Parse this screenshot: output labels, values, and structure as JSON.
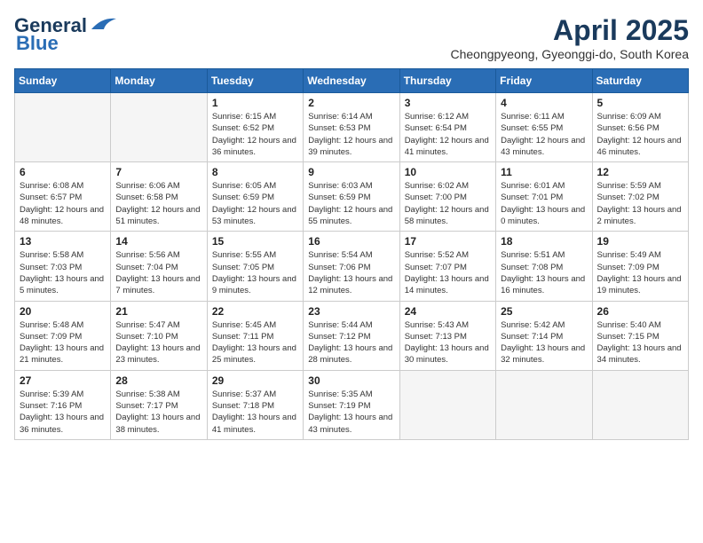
{
  "logo": {
    "general": "General",
    "blue": "Blue"
  },
  "title": {
    "month": "April 2025",
    "location": "Cheongpyeong, Gyeonggi-do, South Korea"
  },
  "headers": [
    "Sunday",
    "Monday",
    "Tuesday",
    "Wednesday",
    "Thursday",
    "Friday",
    "Saturday"
  ],
  "weeks": [
    [
      {
        "day": "",
        "info": ""
      },
      {
        "day": "",
        "info": ""
      },
      {
        "day": "1",
        "info": "Sunrise: 6:15 AM\nSunset: 6:52 PM\nDaylight: 12 hours and 36 minutes."
      },
      {
        "day": "2",
        "info": "Sunrise: 6:14 AM\nSunset: 6:53 PM\nDaylight: 12 hours and 39 minutes."
      },
      {
        "day": "3",
        "info": "Sunrise: 6:12 AM\nSunset: 6:54 PM\nDaylight: 12 hours and 41 minutes."
      },
      {
        "day": "4",
        "info": "Sunrise: 6:11 AM\nSunset: 6:55 PM\nDaylight: 12 hours and 43 minutes."
      },
      {
        "day": "5",
        "info": "Sunrise: 6:09 AM\nSunset: 6:56 PM\nDaylight: 12 hours and 46 minutes."
      }
    ],
    [
      {
        "day": "6",
        "info": "Sunrise: 6:08 AM\nSunset: 6:57 PM\nDaylight: 12 hours and 48 minutes."
      },
      {
        "day": "7",
        "info": "Sunrise: 6:06 AM\nSunset: 6:58 PM\nDaylight: 12 hours and 51 minutes."
      },
      {
        "day": "8",
        "info": "Sunrise: 6:05 AM\nSunset: 6:59 PM\nDaylight: 12 hours and 53 minutes."
      },
      {
        "day": "9",
        "info": "Sunrise: 6:03 AM\nSunset: 6:59 PM\nDaylight: 12 hours and 55 minutes."
      },
      {
        "day": "10",
        "info": "Sunrise: 6:02 AM\nSunset: 7:00 PM\nDaylight: 12 hours and 58 minutes."
      },
      {
        "day": "11",
        "info": "Sunrise: 6:01 AM\nSunset: 7:01 PM\nDaylight: 13 hours and 0 minutes."
      },
      {
        "day": "12",
        "info": "Sunrise: 5:59 AM\nSunset: 7:02 PM\nDaylight: 13 hours and 2 minutes."
      }
    ],
    [
      {
        "day": "13",
        "info": "Sunrise: 5:58 AM\nSunset: 7:03 PM\nDaylight: 13 hours and 5 minutes."
      },
      {
        "day": "14",
        "info": "Sunrise: 5:56 AM\nSunset: 7:04 PM\nDaylight: 13 hours and 7 minutes."
      },
      {
        "day": "15",
        "info": "Sunrise: 5:55 AM\nSunset: 7:05 PM\nDaylight: 13 hours and 9 minutes."
      },
      {
        "day": "16",
        "info": "Sunrise: 5:54 AM\nSunset: 7:06 PM\nDaylight: 13 hours and 12 minutes."
      },
      {
        "day": "17",
        "info": "Sunrise: 5:52 AM\nSunset: 7:07 PM\nDaylight: 13 hours and 14 minutes."
      },
      {
        "day": "18",
        "info": "Sunrise: 5:51 AM\nSunset: 7:08 PM\nDaylight: 13 hours and 16 minutes."
      },
      {
        "day": "19",
        "info": "Sunrise: 5:49 AM\nSunset: 7:09 PM\nDaylight: 13 hours and 19 minutes."
      }
    ],
    [
      {
        "day": "20",
        "info": "Sunrise: 5:48 AM\nSunset: 7:09 PM\nDaylight: 13 hours and 21 minutes."
      },
      {
        "day": "21",
        "info": "Sunrise: 5:47 AM\nSunset: 7:10 PM\nDaylight: 13 hours and 23 minutes."
      },
      {
        "day": "22",
        "info": "Sunrise: 5:45 AM\nSunset: 7:11 PM\nDaylight: 13 hours and 25 minutes."
      },
      {
        "day": "23",
        "info": "Sunrise: 5:44 AM\nSunset: 7:12 PM\nDaylight: 13 hours and 28 minutes."
      },
      {
        "day": "24",
        "info": "Sunrise: 5:43 AM\nSunset: 7:13 PM\nDaylight: 13 hours and 30 minutes."
      },
      {
        "day": "25",
        "info": "Sunrise: 5:42 AM\nSunset: 7:14 PM\nDaylight: 13 hours and 32 minutes."
      },
      {
        "day": "26",
        "info": "Sunrise: 5:40 AM\nSunset: 7:15 PM\nDaylight: 13 hours and 34 minutes."
      }
    ],
    [
      {
        "day": "27",
        "info": "Sunrise: 5:39 AM\nSunset: 7:16 PM\nDaylight: 13 hours and 36 minutes."
      },
      {
        "day": "28",
        "info": "Sunrise: 5:38 AM\nSunset: 7:17 PM\nDaylight: 13 hours and 38 minutes."
      },
      {
        "day": "29",
        "info": "Sunrise: 5:37 AM\nSunset: 7:18 PM\nDaylight: 13 hours and 41 minutes."
      },
      {
        "day": "30",
        "info": "Sunrise: 5:35 AM\nSunset: 7:19 PM\nDaylight: 13 hours and 43 minutes."
      },
      {
        "day": "",
        "info": ""
      },
      {
        "day": "",
        "info": ""
      },
      {
        "day": "",
        "info": ""
      }
    ]
  ]
}
